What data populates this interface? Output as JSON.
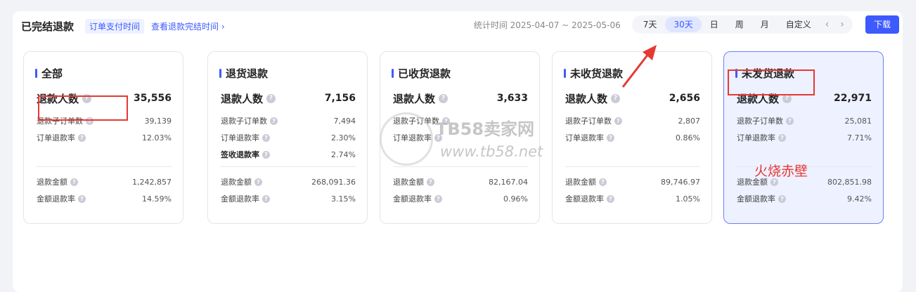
{
  "header": {
    "title": "已完结退款",
    "tab_active": "订单支付时间",
    "link": "查看退款完结时间",
    "link_chevron": "›",
    "stat_time": "统计时间 2025-04-07 ~ 2025-05-06",
    "ranges": [
      "7天",
      "30天",
      "日",
      "周",
      "月",
      "自定义"
    ],
    "active_range": "30天",
    "prev": "‹",
    "next": "›",
    "download": "下载"
  },
  "cards": [
    {
      "title": "全部",
      "main_label": "退款人数",
      "main_value": "35,556",
      "sub1_label": "退款子订单数",
      "sub1_value": "39,139",
      "sub2_label": "订单退款率",
      "sub2_value": "12.03%",
      "sub3_label": "",
      "sub3_value": "",
      "amt_label": "退款金额",
      "amt_value": "1,242,857",
      "amt_rate_label": "金额退款率",
      "amt_rate_value": "14.59%"
    },
    {
      "title": "退货退款",
      "main_label": "退款人数",
      "main_value": "7,156",
      "sub1_label": "退款子订单数",
      "sub1_value": "7,494",
      "sub2_label": "订单退款率",
      "sub2_value": "2.30%",
      "sub3_label": "签收退款率",
      "sub3_value": "2.74%",
      "amt_label": "退款金额",
      "amt_value": "268,091.36",
      "amt_rate_label": "金额退款率",
      "amt_rate_value": "3.15%"
    },
    {
      "title": "已收货退款",
      "main_label": "退款人数",
      "main_value": "3,633",
      "sub1_label": "退款子订单数",
      "sub1_value": "",
      "sub2_label": "订单退款率",
      "sub2_value": "",
      "sub3_label": "",
      "sub3_value": "",
      "amt_label": "退款金额",
      "amt_value": "82,167.04",
      "amt_rate_label": "金额退款率",
      "amt_rate_value": "0.96%"
    },
    {
      "title": "未收货退款",
      "main_label": "退款人数",
      "main_value": "2,656",
      "sub1_label": "退款子订单数",
      "sub1_value": "2,807",
      "sub2_label": "订单退款率",
      "sub2_value": "0.86%",
      "sub3_label": "",
      "sub3_value": "",
      "amt_label": "退款金额",
      "amt_value": "89,746.97",
      "amt_rate_label": "金额退款率",
      "amt_rate_value": "1.05%"
    },
    {
      "title": "未发货退款",
      "main_label": "退款人数",
      "main_value": "22,971",
      "sub1_label": "退款子订单数",
      "sub1_value": "25,081",
      "sub2_label": "订单退款率",
      "sub2_value": "7.71%",
      "sub3_label": "",
      "sub3_value": "",
      "amt_label": "退款金额",
      "amt_value": "802,851.98",
      "amt_rate_label": "金额退款率",
      "amt_rate_value": "9.42%"
    }
  ],
  "help_glyph": "?",
  "watermark": {
    "line1": "TB58卖家网",
    "line2": "www.tb58.net"
  },
  "annotation_text": "火烧赤壁",
  "colors": {
    "accent": "#3d5afe",
    "annotation": "#e53935",
    "selected_bg": "#eef1ff"
  }
}
